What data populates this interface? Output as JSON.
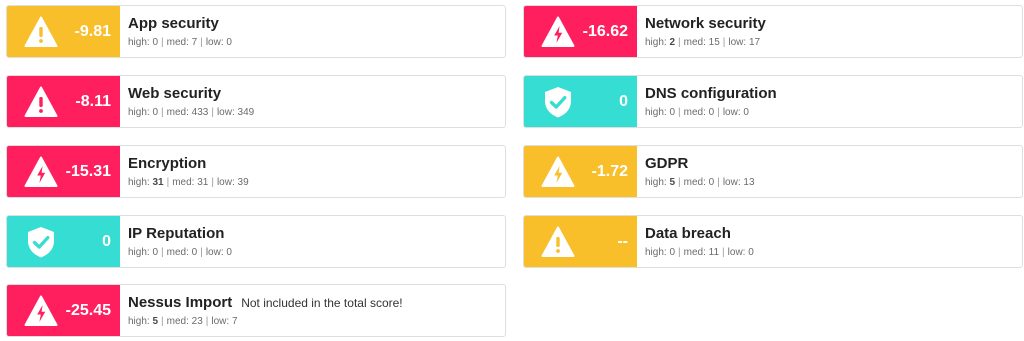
{
  "colors": {
    "high": "#ff1f5f",
    "medium": "#f8bf2b",
    "ok": "#36ddd2"
  },
  "labels": {
    "high": "high:",
    "med": "med:",
    "low": "low:",
    "sep": "|"
  },
  "cards": [
    {
      "title": "App security",
      "score": "-9.81",
      "icon": "warning-triangle-icon",
      "color": "medium",
      "high": "0",
      "med": "7",
      "low": "0",
      "high_bold": false,
      "note": ""
    },
    {
      "title": "Network security",
      "score": "-16.62",
      "icon": "lightning-triangle-icon",
      "color": "high",
      "high": "2",
      "med": "15",
      "low": "17",
      "high_bold": true,
      "note": ""
    },
    {
      "title": "Web security",
      "score": "-8.11",
      "icon": "warning-triangle-icon",
      "color": "high",
      "high": "0",
      "med": "433",
      "low": "349",
      "high_bold": false,
      "note": ""
    },
    {
      "title": "DNS configuration",
      "score": "0",
      "icon": "shield-check-icon",
      "color": "ok",
      "high": "0",
      "med": "0",
      "low": "0",
      "high_bold": false,
      "note": ""
    },
    {
      "title": "Encryption",
      "score": "-15.31",
      "icon": "lightning-triangle-icon",
      "color": "high",
      "high": "31",
      "med": "31",
      "low": "39",
      "high_bold": true,
      "note": ""
    },
    {
      "title": "GDPR",
      "score": "-1.72",
      "icon": "lightning-triangle-icon",
      "color": "medium",
      "high": "5",
      "med": "0",
      "low": "13",
      "high_bold": true,
      "note": ""
    },
    {
      "title": "IP Reputation",
      "score": "0",
      "icon": "shield-check-icon",
      "color": "ok",
      "high": "0",
      "med": "0",
      "low": "0",
      "high_bold": false,
      "note": ""
    },
    {
      "title": "Data breach",
      "score": "--",
      "icon": "warning-triangle-icon",
      "color": "medium",
      "high": "0",
      "med": "11",
      "low": "0",
      "high_bold": false,
      "note": ""
    },
    {
      "title": "Nessus Import",
      "score": "-25.45",
      "icon": "lightning-triangle-icon",
      "color": "high",
      "high": "5",
      "med": "23",
      "low": "7",
      "high_bold": true,
      "note": "Not included in the total score!"
    }
  ]
}
